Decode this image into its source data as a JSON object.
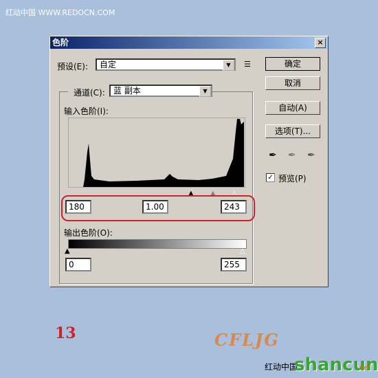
{
  "watermark_top": "红动中国 WWW.REDOCN.COM",
  "dialog": {
    "title": "色阶",
    "close": "×",
    "preset_label": "预设(E):",
    "preset_value": "自定",
    "channel_label": "通道(C):",
    "channel_value": "蓝 副本",
    "input_label": "输入色阶(I):",
    "input_black": "180",
    "input_gamma": "1.00",
    "input_white": "243",
    "output_label": "输出色阶(O):",
    "output_black": "0",
    "output_white": "255",
    "buttons": {
      "ok": "确定",
      "cancel": "取消",
      "auto": "自动(A)",
      "options": "选项(T)..."
    },
    "preview_label": "预览(P)",
    "preview_checked": true
  },
  "step_number": "13",
  "logo_text": "CFLJG",
  "watermark_bottom": "红动中国",
  "watermark_brand": "shancun",
  "watermark_brand_suffix": ".net",
  "highlight_color": "#d0202a"
}
